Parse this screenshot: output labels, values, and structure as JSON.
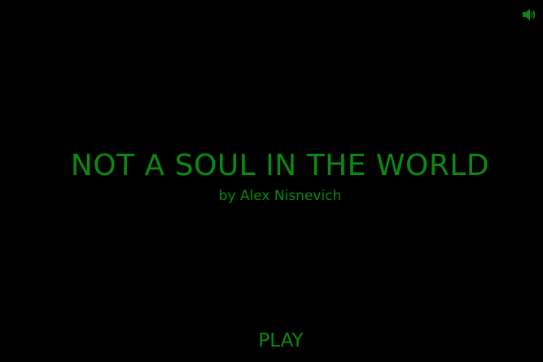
{
  "game": {
    "title": "NOT A SOUL IN THE WORLD",
    "byline": "by Alex Nisnevich",
    "play_label": "PLAY"
  },
  "controls": {
    "sound_icon": "speaker-icon"
  },
  "colors": {
    "background": "#000000",
    "accent": "#0b8a12"
  }
}
